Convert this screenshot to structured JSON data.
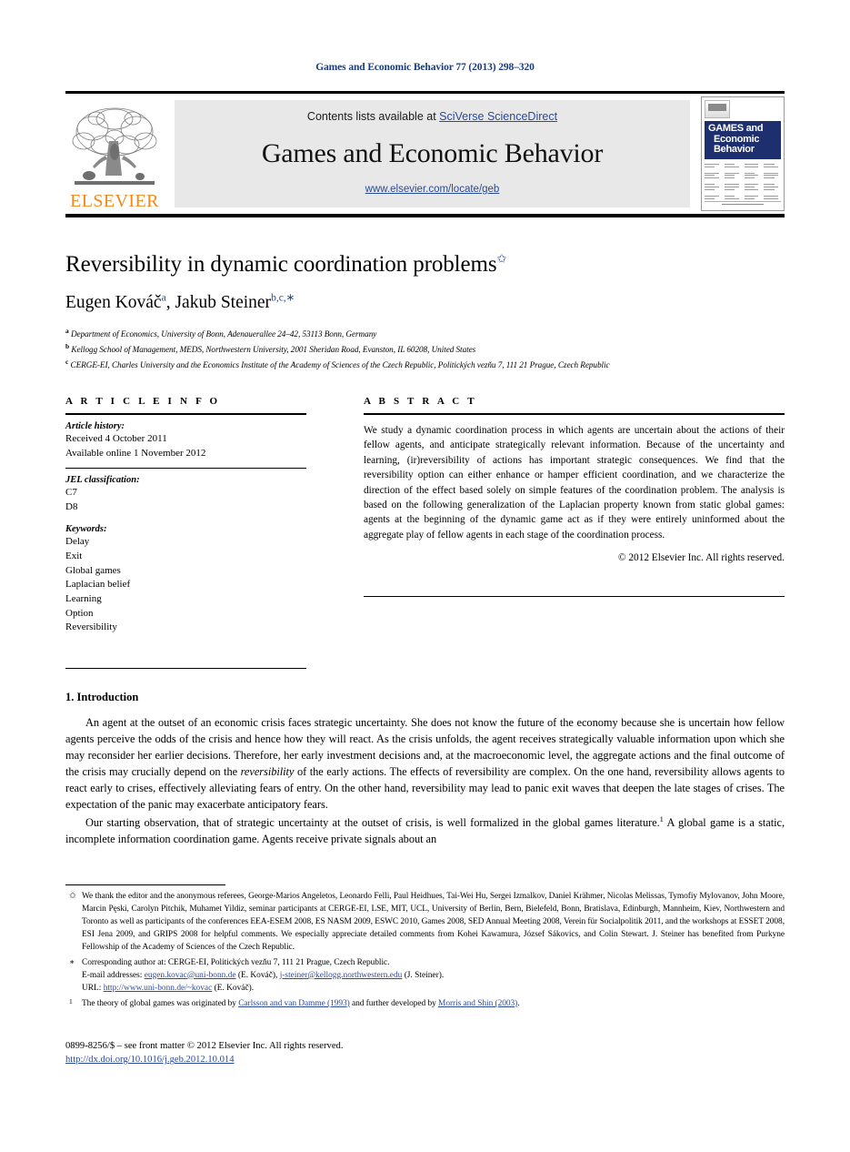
{
  "running_head": "Games and Economic Behavior 77 (2013) 298–320",
  "masthead": {
    "publisher_name": "ELSEVIER",
    "contents_prefix": "Contents lists available at ",
    "sciencedirect_link": "SciVerse ScienceDirect",
    "journal_title": "Games and Economic Behavior",
    "journal_url": "www.elsevier.com/locate/geb",
    "cover": {
      "line1": "GAMES and",
      "line2": "Economic",
      "line3": "Behavior"
    }
  },
  "article": {
    "title": "Reversibility in dynamic coordination problems",
    "title_footnote_mark": "✩",
    "authors_html": "Eugen Kováč , Jakub Steiner",
    "author1": "Eugen Kováč",
    "author1_sup": "a",
    "author2": "Jakub Steiner",
    "author2_sup": "b,c,",
    "author2_star": "∗",
    "affiliations": [
      {
        "mark": "a",
        "text": "Department of Economics, University of Bonn, Adenauerallee 24–42, 53113 Bonn, Germany"
      },
      {
        "mark": "b",
        "text": "Kellogg School of Management, MEDS, Northwestern University, 2001 Sheridan Road, Evanston, IL 60208, United States"
      },
      {
        "mark": "c",
        "text": "CERGE-EI, Charles University and the Economics Institute of the Academy of Sciences of the Czech Republic, Politických vezňu 7, 111 21 Prague, Czech Republic"
      }
    ]
  },
  "article_info": {
    "heading": "A R T I C L E   I N F O",
    "history_label": "Article history:",
    "history_lines": [
      "Received 4 October 2011",
      "Available online 1 November 2012"
    ],
    "jel_label": "JEL classification:",
    "jel_codes": [
      "C7",
      "D8"
    ],
    "keywords_label": "Keywords:",
    "keywords": [
      "Delay",
      "Exit",
      "Global games",
      "Laplacian belief",
      "Learning",
      "Option",
      "Reversibility"
    ]
  },
  "abstract": {
    "heading": "A B S T R A C T",
    "text": "We study a dynamic coordination process in which agents are uncertain about the actions of their fellow agents, and anticipate strategically relevant information. Because of the uncertainty and learning, (ir)reversibility of actions has important strategic consequences. We find that the reversibility option can either enhance or hamper efficient coordination, and we characterize the direction of the effect based solely on simple features of the coordination problem. The analysis is based on the following generalization of the Laplacian property known from static global games: agents at the beginning of the dynamic game act as if they were entirely uninformed about the aggregate play of fellow agents in each stage of the coordination process.",
    "copyright": "© 2012 Elsevier Inc. All rights reserved."
  },
  "body": {
    "section_number": "1.",
    "section_title": "Introduction",
    "paragraph1_a": "An agent at the outset of an economic crisis faces strategic uncertainty. She does not know the future of the economy because she is uncertain how fellow agents perceive the odds of the crisis and hence how they will react. As the crisis unfolds, the agent receives strategically valuable information upon which she may reconsider her earlier decisions. Therefore, her early investment decisions and, at the macroeconomic level, the aggregate actions and the final outcome of the crisis may crucially depend on the ",
    "paragraph1_em": "reversibility",
    "paragraph1_b": " of the early actions. The effects of reversibility are complex. On the one hand, reversibility allows agents to react early to crises, effectively alleviating fears of entry. On the other hand, reversibility may lead to panic exit waves that deepen the late stages of crises. The expectation of the panic may exacerbate anticipatory fears.",
    "paragraph2_a": "Our starting observation, that of strategic uncertainty at the outset of crisis, is well formalized in the global games literature.",
    "paragraph2_sup": "1",
    "paragraph2_b": " A global game is a static, incomplete information coordination game. Agents receive private signals about an"
  },
  "footnotes": {
    "acknowledgement_mark": "✩",
    "acknowledgement": "We thank the editor and the anonymous referees, George-Marios Angeletos, Leonardo Felli, Paul Heidhues, Tai-Wei Hu, Sergei Izmalkov, Daniel Krähmer, Nicolas Melissas, Tymofiy Mylovanov, John Moore, Marcin Pęski, Carolyn Pitchik, Muhamet Yildiz, seminar participants at CERGE-EI, LSE, MIT, UCL, University of Berlin, Bern, Bielefeld, Bonn, Bratislava, Edinburgh, Mannheim, Kiev, Northwestern and Toronto as well as participants of the conferences EEA-ESEM 2008, ES NASM 2009, ESWC 2010, Games 2008, SED Annual Meeting 2008, Verein für Socialpolitik 2011, and the workshops at ESSET 2008, ESI Jena 2009, and GRIPS 2008 for helpful comments. We especially appreciate detailed comments from Kohei Kawamura, József Sákovics, and Colin Stewart. J. Steiner has benefited from Purkyne Fellowship of the Academy of Sciences of the Czech Republic.",
    "corresponding_mark": "∗",
    "corresponding": "Corresponding author at: CERGE-EI, Politických vezňu 7, 111 21 Prague, Czech Republic.",
    "email_label": "E-mail addresses:",
    "email1": "eugen.kovac@uni-bonn.de",
    "email1_owner": " (E. Kováč), ",
    "email2": "j-steiner@kellogg.northwestern.edu",
    "email2_owner": " (J. Steiner).",
    "url_label": "URL:",
    "url_value": "http://www.uni-bonn.de/~kovac",
    "url_owner": " (E. Kováč).",
    "note1_mark": "1",
    "note1_a": "The theory of global games was originated by ",
    "note1_cite1": "Carlsson and van Damme (1993)",
    "note1_b": " and further developed by ",
    "note1_cite2": "Morris and Shin (2003)",
    "note1_c": "."
  },
  "footer": {
    "issn_line": "0899-8256/$ – see front matter  © 2012 Elsevier Inc. All rights reserved.",
    "doi": "http://dx.doi.org/10.1016/j.geb.2012.10.014"
  },
  "colors": {
    "link": "#2a4a9a",
    "running_head": "#1a3a7a",
    "elsevier_orange": "#f08a1c",
    "cover_navy": "#1d2f6e",
    "band_grey": "#e8e8e8"
  }
}
